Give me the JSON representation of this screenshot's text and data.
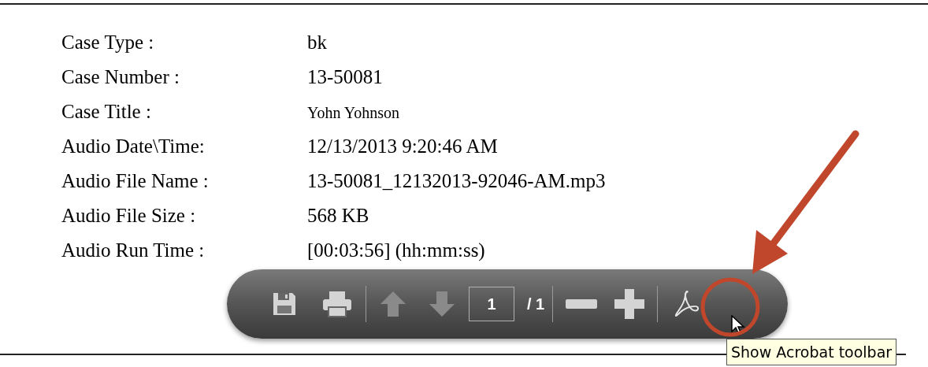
{
  "fields": [
    {
      "label": "Case Type :",
      "value": "bk",
      "kind": "normal"
    },
    {
      "label": "Case Number :",
      "value": "13-50081",
      "kind": "normal"
    },
    {
      "label": "Case Title :",
      "value": "Yohn Yohnson",
      "kind": "small"
    },
    {
      "label": "Audio Date\\Time:",
      "value": "12/13/2013 9:20:46 AM",
      "kind": "normal"
    },
    {
      "label": "Audio File Name :",
      "value": "13-50081_12132013-92046-AM.mp3",
      "kind": "normal"
    },
    {
      "label": "Audio File Size :",
      "value": "568 KB",
      "kind": "normal"
    },
    {
      "label": "Audio Run Time :",
      "value": "[00:03:56] (hh:mm:ss)",
      "kind": "normal"
    }
  ],
  "toolbar": {
    "buttons": [
      {
        "kind": "save",
        "disabled": false
      },
      {
        "kind": "print",
        "disabled": false
      },
      {
        "kind": "up",
        "disabled": true
      },
      {
        "kind": "down",
        "disabled": true
      }
    ],
    "page_field": {
      "value": "1"
    },
    "page_total": "/ 1",
    "zoom_buttons": [
      {
        "kind": "minus",
        "disabled": false
      },
      {
        "kind": "plus",
        "disabled": false
      }
    ],
    "tooltip": "Show Acrobat toolbar"
  }
}
